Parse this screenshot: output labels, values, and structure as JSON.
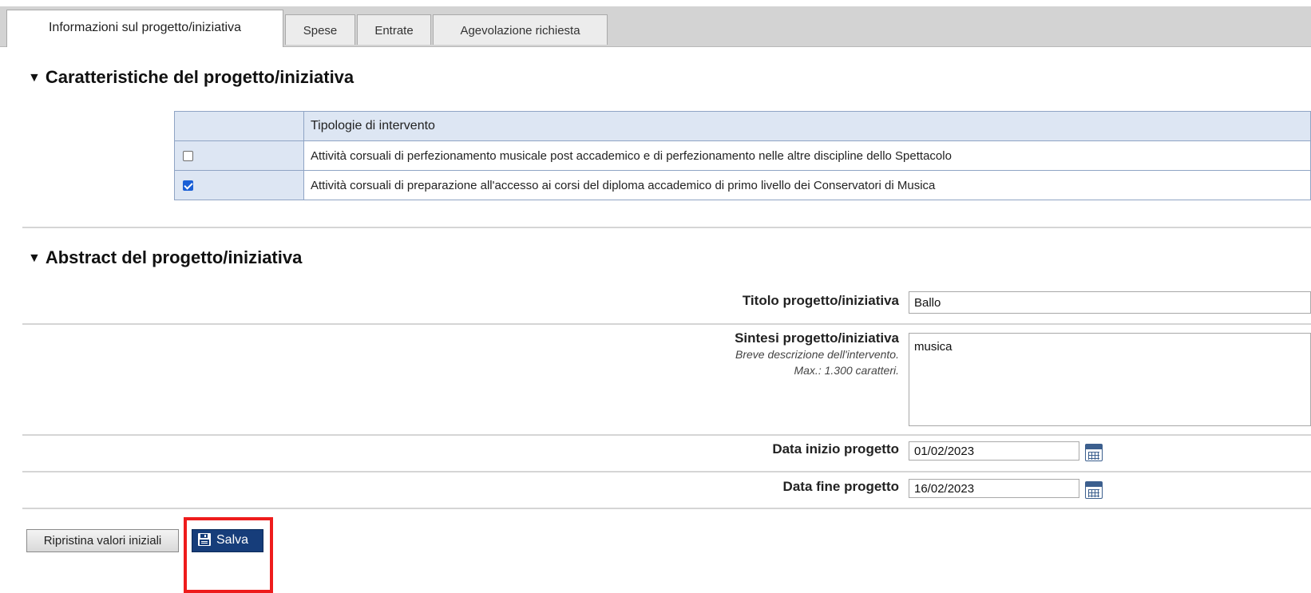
{
  "tabs": [
    {
      "label": "Informazioni sul progetto/iniziativa",
      "active": true
    },
    {
      "label": "Spese",
      "active": false
    },
    {
      "label": "Entrate",
      "active": false
    },
    {
      "label": "Agevolazione richiesta",
      "active": false
    }
  ],
  "section1": {
    "title": "Caratteristiche del progetto/iniziativa",
    "table_header": "Tipologie di intervento",
    "rows": [
      {
        "checked": false,
        "text": "Attività corsuali di perfezionamento musicale post accademico e di perfezionamento nelle altre discipline dello Spettacolo"
      },
      {
        "checked": true,
        "text": "Attività corsuali di preparazione all'accesso ai corsi del diploma accademico di primo livello dei Conservatori di Musica"
      }
    ]
  },
  "section2": {
    "title": "Abstract del progetto/iniziativa",
    "titolo_label": "Titolo progetto/iniziativa",
    "titolo_value": "Ballo",
    "sintesi_label": "Sintesi progetto/iniziativa",
    "sintesi_hint1": "Breve descrizione dell'intervento.",
    "sintesi_hint2": "Max.: 1.300 caratteri.",
    "sintesi_value": "musica",
    "data_inizio_label": "Data inizio progetto",
    "data_inizio_value": "01/02/2023",
    "data_fine_label": "Data fine progetto",
    "data_fine_value": "16/02/2023"
  },
  "buttons": {
    "reset_label": "Ripristina valori iniziali",
    "save_label": "Salva"
  },
  "colors": {
    "highlight": "#ee1c1c",
    "save_button": "#163d7a",
    "table_border": "#8fa4c4",
    "checkbox_checked": "#1a5fd6"
  }
}
